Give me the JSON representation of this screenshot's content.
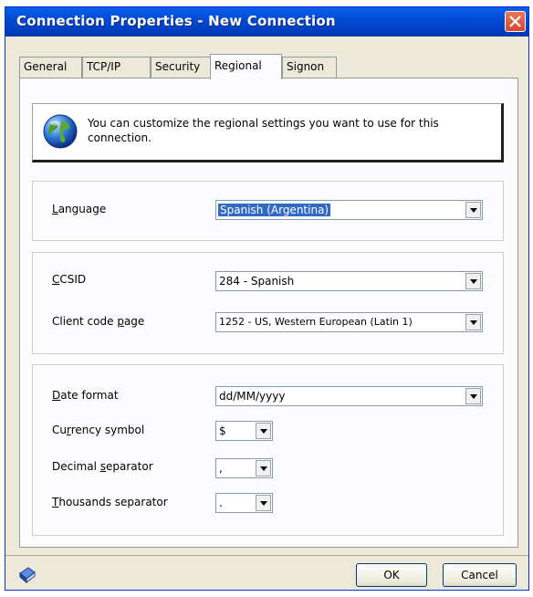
{
  "window": {
    "title": "Connection Properties - New Connection"
  },
  "tabs": [
    {
      "label": "General"
    },
    {
      "label": "TCP/IP"
    },
    {
      "label": "Security"
    },
    {
      "label": "Regional"
    },
    {
      "label": "Signon"
    }
  ],
  "info": {
    "text": "You can customize the regional settings you want to use for this connection."
  },
  "language": {
    "label_ul": "L",
    "label_rest": "anguage",
    "value": "Spanish (Argentina)"
  },
  "ccsid": {
    "label_ul": "C",
    "label_rest": "CSID",
    "value": "284 - Spanish"
  },
  "client_code_page": {
    "label_pre": "Client code ",
    "label_ul": "p",
    "label_post": "age",
    "value": "1252 - US, Western European (Latin 1)"
  },
  "date_format": {
    "label_ul": "D",
    "label_rest": "ate format",
    "value": "dd/MM/yyyy"
  },
  "currency_symbol": {
    "label_pre": "Cu",
    "label_ul": "r",
    "label_post": "rency symbol",
    "value": "$"
  },
  "decimal_separator": {
    "label_pre": "Decimal ",
    "label_ul": "s",
    "label_post": "eparator",
    "value": ","
  },
  "thousands_separator": {
    "label_ul": "T",
    "label_rest": "housands separator",
    "value": "."
  },
  "buttons": {
    "ok": "OK",
    "cancel": "Cancel"
  },
  "icons": {
    "close": "close-icon",
    "info": "globe-icon",
    "help": "help-book-icon"
  },
  "colors": {
    "titlebar": "#0049d3",
    "selection": "#316ac5",
    "close": "#d5492c"
  }
}
